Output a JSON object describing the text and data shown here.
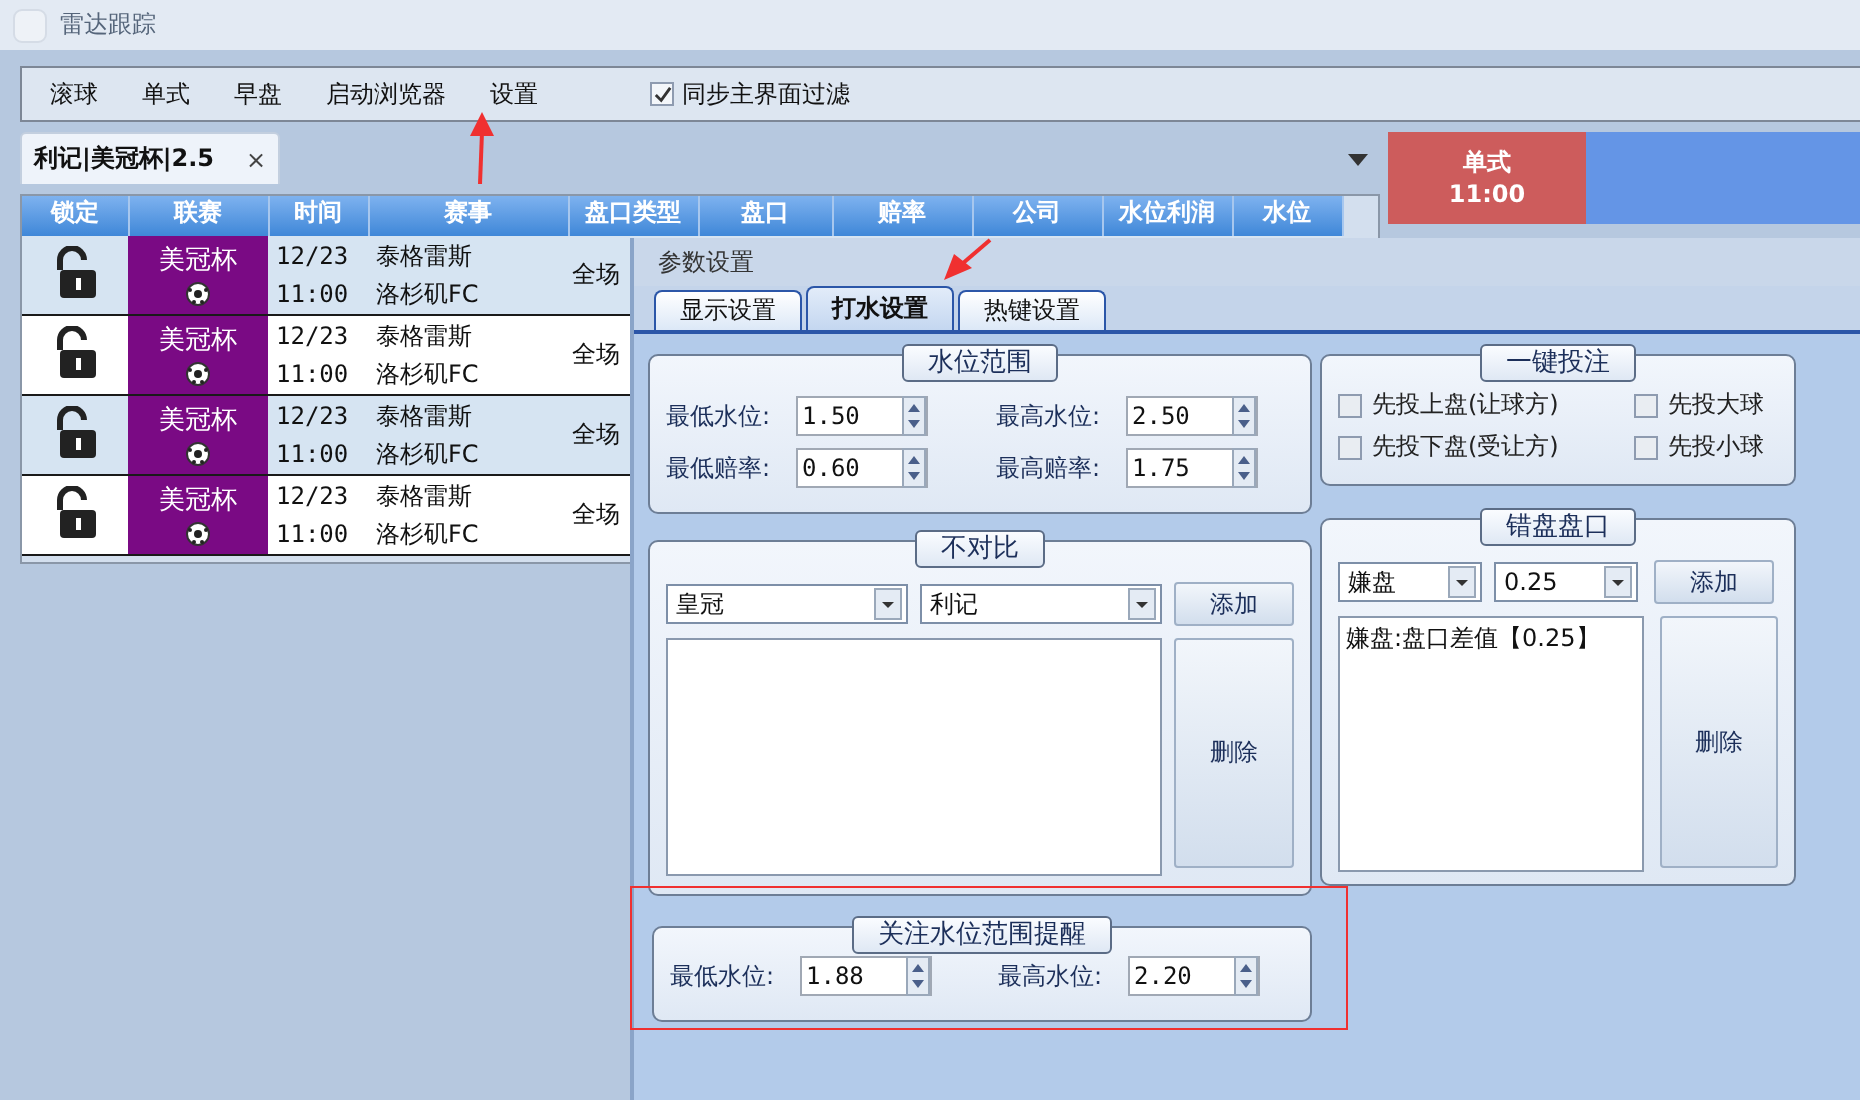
{
  "window": {
    "title": "雷达跟踪"
  },
  "toolbar": {
    "items": [
      "滚球",
      "单式",
      "早盘",
      "启动浏览器",
      "设置"
    ],
    "sync_filter": {
      "label": "同步主界面过滤",
      "checked": true
    }
  },
  "tabs": [
    {
      "label": "利记|美冠杯|2.5",
      "selected": true,
      "close": "×"
    }
  ],
  "banner": {
    "line1": "单式",
    "line2": "11:00"
  },
  "table": {
    "columns": [
      "锁定",
      "联赛",
      "时间",
      "赛事",
      "盘口类型",
      "盘口",
      "赔率",
      "公司",
      "水位利润",
      "水位"
    ],
    "rows": [
      {
        "locked": false,
        "league": "美冠杯",
        "date": "12/23",
        "time": "11:00",
        "home": "泰格雷斯",
        "away": "洛杉矶FC",
        "handicap_type": "全场"
      },
      {
        "locked": false,
        "league": "美冠杯",
        "date": "12/23",
        "time": "11:00",
        "home": "泰格雷斯",
        "away": "洛杉矶FC",
        "handicap_type": "全场"
      },
      {
        "locked": false,
        "league": "美冠杯",
        "date": "12/23",
        "time": "11:00",
        "home": "泰格雷斯",
        "away": "洛杉矶FC",
        "handicap_type": "全场"
      },
      {
        "locked": false,
        "league": "美冠杯",
        "date": "12/23",
        "time": "11:00",
        "home": "泰格雷斯",
        "away": "洛杉矶FC",
        "handicap_type": "全场"
      }
    ]
  },
  "dialog": {
    "title": "参数设置",
    "tabs": [
      {
        "label": "显示设置",
        "selected": false
      },
      {
        "label": "打水设置",
        "selected": true
      },
      {
        "label": "热键设置",
        "selected": false
      }
    ],
    "water_range": {
      "title": "水位范围",
      "fields": [
        {
          "label": "最低水位:",
          "value": "1.50"
        },
        {
          "label": "最高水位:",
          "value": "2.50"
        },
        {
          "label": "最低赔率:",
          "value": "0.60"
        },
        {
          "label": "最高赔率:",
          "value": "1.75"
        }
      ]
    },
    "exclude": {
      "title": "不对比",
      "selects": [
        "皇冠",
        "利记"
      ],
      "add": "添加",
      "delete": "删除"
    },
    "alert": {
      "title": "关注水位范围提醒",
      "fields": [
        {
          "label": "最低水位:",
          "value": "1.88"
        },
        {
          "label": "最高水位:",
          "value": "2.20"
        }
      ]
    },
    "one_click": {
      "title": "一键投注",
      "options": [
        {
          "label": "先投上盘(让球方)",
          "checked": false
        },
        {
          "label": "先投大球",
          "checked": false
        },
        {
          "label": "先投下盘(受让方)",
          "checked": false
        },
        {
          "label": "先投小球",
          "checked": false
        }
      ]
    },
    "wrong_line": {
      "title": "错盘盘口",
      "selects": [
        "嫌盘",
        "0.25"
      ],
      "add": "添加",
      "delete": "删除",
      "items": [
        "嫌盘:盘口差值【0.25】"
      ]
    }
  }
}
